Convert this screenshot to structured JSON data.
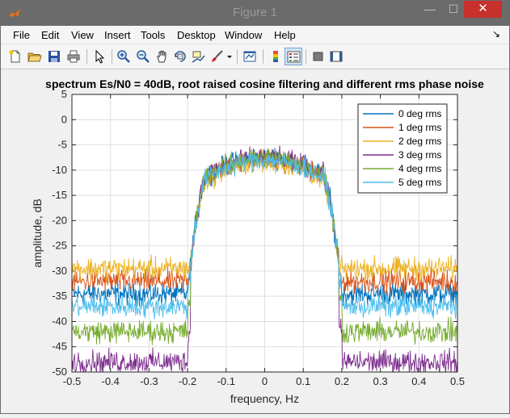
{
  "window": {
    "title": "Figure 1",
    "minimize_glyph": "—",
    "maximize_glyph": "☐",
    "close_glyph": "✕"
  },
  "menu": {
    "items": [
      "File",
      "Edit",
      "View",
      "Insert",
      "Tools",
      "Desktop",
      "Window",
      "Help"
    ],
    "dock_arrow": "↘"
  },
  "toolbar": {
    "tools": [
      "new-figure-icon",
      "open-file-icon",
      "save-icon",
      "print-icon",
      "pointer-icon",
      "zoom-in-icon",
      "zoom-out-icon",
      "pan-hand-icon",
      "rotate-3d-icon",
      "data-cursor-icon",
      "brush-icon",
      "brush-dropdown-icon",
      "link-plot-icon",
      "colorbar-icon",
      "legend-icon",
      "hide-plot-tools-icon",
      "show-plot-tools-icon"
    ]
  },
  "chart_data": {
    "type": "line",
    "title": "spectrum Es/N0 = 40dB, root raised cosine filtering and different rms phase noise",
    "xlabel": "frequency, Hz",
    "ylabel": "amplitude, dB",
    "xlim": [
      -0.5,
      0.5
    ],
    "ylim": [
      -50,
      5
    ],
    "xticks": [
      "-0.5",
      "-0.4",
      "-0.3",
      "-0.2",
      "-0.1",
      "0",
      "0.1",
      "0.2",
      "0.3",
      "0.4",
      "0.5"
    ],
    "yticks": [
      "5",
      "0",
      "-5",
      "-10",
      "-15",
      "-20",
      "-25",
      "-30",
      "-35",
      "-40",
      "-45",
      "-50"
    ],
    "grid": true,
    "legend_position": "top-right",
    "passband_edge_hz": 0.2,
    "series": [
      {
        "name": "0 deg rms",
        "color": "#0072BD",
        "passband_level_db": -7.5,
        "floor_db": -34.5,
        "noise_spread_db": 1.6
      },
      {
        "name": "1 deg rms",
        "color": "#D95319",
        "passband_level_db": -7.8,
        "floor_db": -32,
        "noise_spread_db": 1.6
      },
      {
        "name": "2 deg rms",
        "color": "#EDB120",
        "passband_level_db": -8.5,
        "floor_db": -29.5,
        "noise_spread_db": 1.6
      },
      {
        "name": "3 deg rms",
        "color": "#7E2F8E",
        "passband_level_db": -7.5,
        "floor_db": -48,
        "noise_spread_db": 1.6
      },
      {
        "name": "4 deg rms",
        "color": "#77AC30",
        "passband_level_db": -7.5,
        "floor_db": -42,
        "noise_spread_db": 1.6
      },
      {
        "name": "5 deg rms",
        "color": "#4DBEEE",
        "passband_level_db": -8,
        "floor_db": -37,
        "noise_spread_db": 1.6
      }
    ]
  }
}
